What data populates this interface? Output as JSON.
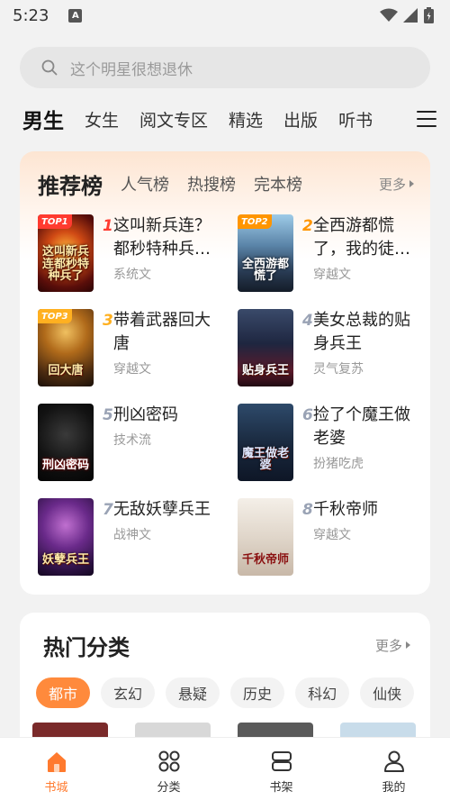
{
  "status": {
    "time": "5:23",
    "notification_icon": "a-icon"
  },
  "search": {
    "placeholder": "这个明星很想退休"
  },
  "channels": [
    "男生",
    "女生",
    "阅文专区",
    "精选",
    "出版",
    "听书"
  ],
  "ranking": {
    "title": "推荐榜",
    "tabs": [
      "人气榜",
      "热搜榜",
      "完本榜"
    ],
    "more": "更多",
    "books": [
      {
        "rank": "1",
        "badge": "TOP1",
        "title": "这叫新兵连？都秒特种兵…",
        "tag": "系统文",
        "cover_text": "这叫新兵连都秒特种兵了"
      },
      {
        "rank": "2",
        "badge": "TOP2",
        "title": "全西游都慌了，我的徒…",
        "tag": "穿越文",
        "cover_text": "全西游都慌了"
      },
      {
        "rank": "3",
        "badge": "TOP3",
        "title": "带着武器回大唐",
        "tag": "穿越文",
        "cover_text": "回大唐"
      },
      {
        "rank": "4",
        "badge": "",
        "title": "美女总裁的贴身兵王",
        "tag": "灵气复苏",
        "cover_text": "贴身兵王"
      },
      {
        "rank": "5",
        "badge": "",
        "title": "刑凶密码",
        "tag": "技术流",
        "cover_text": "刑凶密码"
      },
      {
        "rank": "6",
        "badge": "",
        "title": "捡了个魔王做老婆",
        "tag": "扮猪吃虎",
        "cover_text": "魔王做老婆"
      },
      {
        "rank": "7",
        "badge": "",
        "title": "无敌妖孽兵王",
        "tag": "战神文",
        "cover_text": "妖孽兵王"
      },
      {
        "rank": "8",
        "badge": "",
        "title": "千秋帝师",
        "tag": "穿越文",
        "cover_text": "千秋帝师"
      }
    ]
  },
  "hot": {
    "title": "热门分类",
    "more": "更多",
    "categories": [
      "都市",
      "玄幻",
      "悬疑",
      "历史",
      "科幻",
      "仙侠"
    ]
  },
  "nav": [
    "书城",
    "分类",
    "书架",
    "我的"
  ],
  "colors": {
    "accent": "#ff7a2e",
    "rank_top": "#ff3b30",
    "rank_second": "#ff9500",
    "rank_third": "#ffb020",
    "rank_other": "#9aa3b5"
  }
}
